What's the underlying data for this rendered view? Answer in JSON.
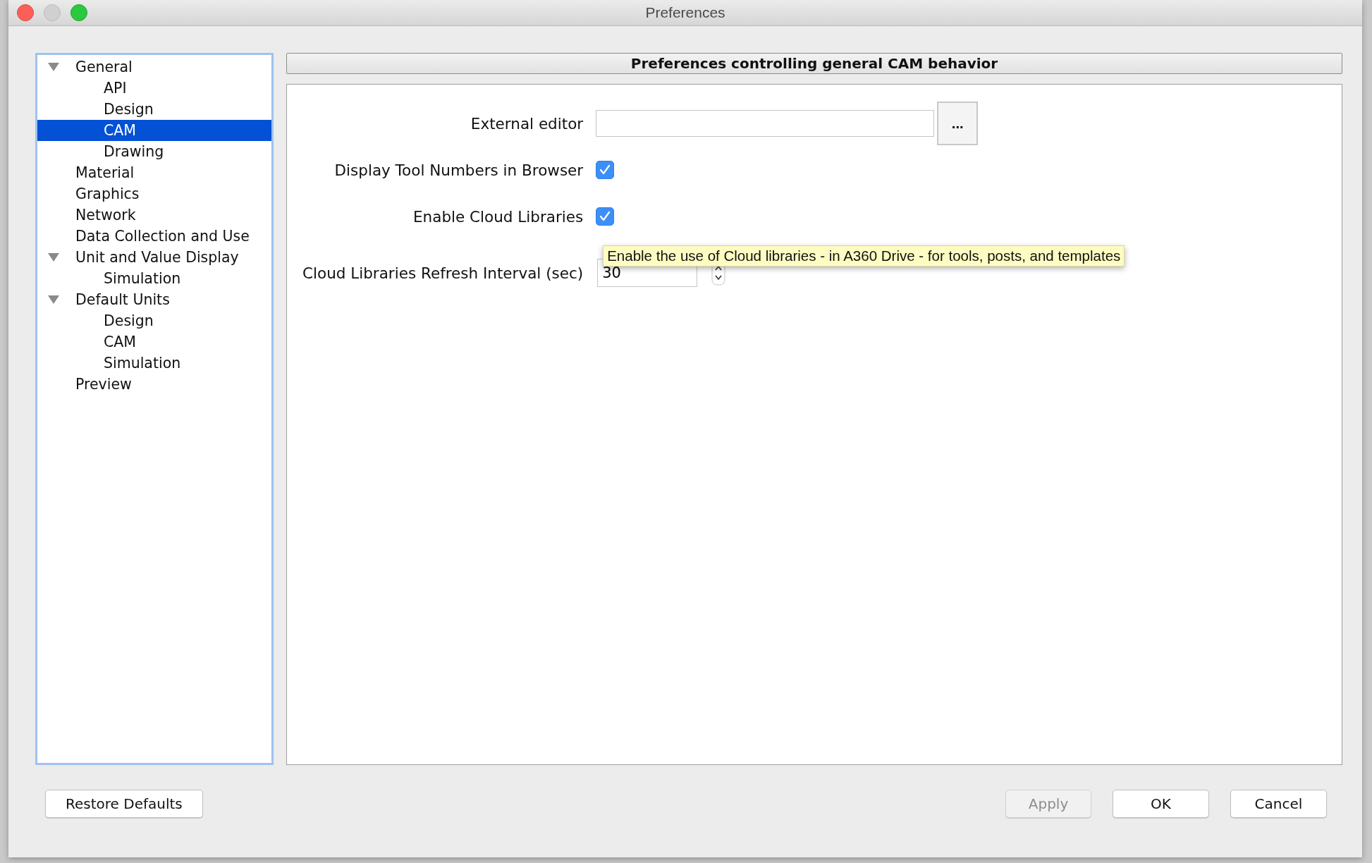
{
  "window": {
    "title": "Preferences"
  },
  "tree": [
    {
      "label": "General",
      "expanded": true,
      "selected": false,
      "children": [
        {
          "label": "API",
          "selected": false
        },
        {
          "label": "Design",
          "selected": false
        },
        {
          "label": "CAM",
          "selected": true
        },
        {
          "label": "Drawing",
          "selected": false
        }
      ]
    },
    {
      "label": "Material",
      "selected": false
    },
    {
      "label": "Graphics",
      "selected": false
    },
    {
      "label": "Network",
      "selected": false
    },
    {
      "label": "Data Collection and Use",
      "selected": false
    },
    {
      "label": "Unit and Value Display",
      "expanded": true,
      "selected": false,
      "children": [
        {
          "label": "Simulation",
          "selected": false
        }
      ]
    },
    {
      "label": "Default Units",
      "expanded": true,
      "selected": false,
      "children": [
        {
          "label": "Design",
          "selected": false
        },
        {
          "label": "CAM",
          "selected": false
        },
        {
          "label": "Simulation",
          "selected": false
        }
      ]
    },
    {
      "label": "Preview",
      "selected": false
    }
  ],
  "panel": {
    "header": "Preferences controlling general CAM behavior",
    "fields": [
      {
        "kind": "file",
        "label": "External editor",
        "button": "..."
      },
      {
        "kind": "checkbox",
        "label": "Display Tool Numbers in Browser",
        "checked": true
      },
      {
        "kind": "checkbox",
        "label": "Enable Cloud Libraries",
        "checked": true
      },
      {
        "kind": "spin",
        "label": "Cloud Libraries Refresh Interval (sec)",
        "value": "30"
      }
    ],
    "tooltip": "Enable the use of Cloud libraries - in A360 Drive - for tools, posts, and templates"
  },
  "footer": {
    "left_buttons": [
      {
        "label": "Restore Defaults",
        "disabled": false
      }
    ],
    "right_buttons": [
      {
        "label": "Apply",
        "disabled": true
      },
      {
        "label": "OK",
        "disabled": false
      },
      {
        "label": "Cancel",
        "disabled": false
      }
    ]
  }
}
